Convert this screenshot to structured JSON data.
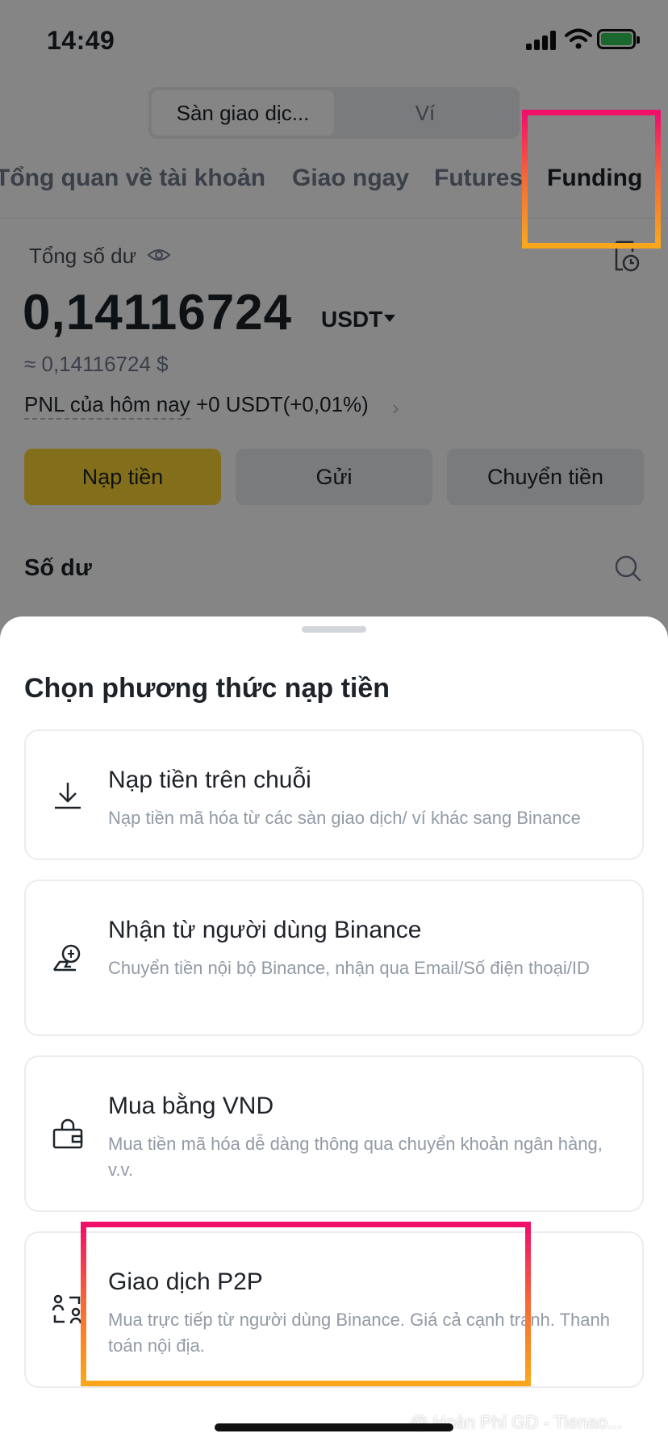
{
  "status_bar": {
    "time": "14:49"
  },
  "header": {
    "segments": [
      "Sàn giao dịc...",
      "Ví"
    ]
  },
  "tabs": [
    "Tổng quan về tài khoản",
    "Giao ngay",
    "Futures",
    "Funding"
  ],
  "balance": {
    "label": "Tổng số dư",
    "value": "0,14116724",
    "unit": "USDT",
    "fiat": "≈ 0,14116724 $",
    "pnl_label": "PNL của hôm nay",
    "pnl_value": "+0 USDT(+0,01%)",
    "pnl_arrow": "›"
  },
  "actions": {
    "deposit": "Nạp tiền",
    "send": "Gửi",
    "transfer": "Chuyển tiền"
  },
  "balances_section": {
    "title": "Số dư"
  },
  "sheet": {
    "title": "Chọn phương thức nạp tiền",
    "options": [
      {
        "icon": "download-icon",
        "title": "Nạp tiền trên chuỗi",
        "desc": "Nạp tiền mã hóa từ các sàn giao dịch/ ví khác sang Binance"
      },
      {
        "icon": "receive-icon",
        "title": "Nhận từ người dùng Binance",
        "desc": "Chuyển tiền nội bộ Binance, nhận qua Email/Số điện thoại/ID"
      },
      {
        "icon": "wallet-lock-icon",
        "title": "Mua bằng VND",
        "desc": "Mua tiền mã hóa dễ dàng thông qua chuyển khoản ngân hàng, v.v."
      },
      {
        "icon": "p2p-icon",
        "title": "Giao dịch P2P",
        "desc": "Mua trực tiếp từ người dùng Binance. Giá cả cạnh tranh. Thanh toán nội địa."
      }
    ]
  },
  "watermark": "@ Hoàn Phí GD - Tienao...",
  "colors": {
    "brand_yellow": "#fcd535",
    "highlight_top": "#f0106a",
    "highlight_bottom": "#f9a61d"
  }
}
